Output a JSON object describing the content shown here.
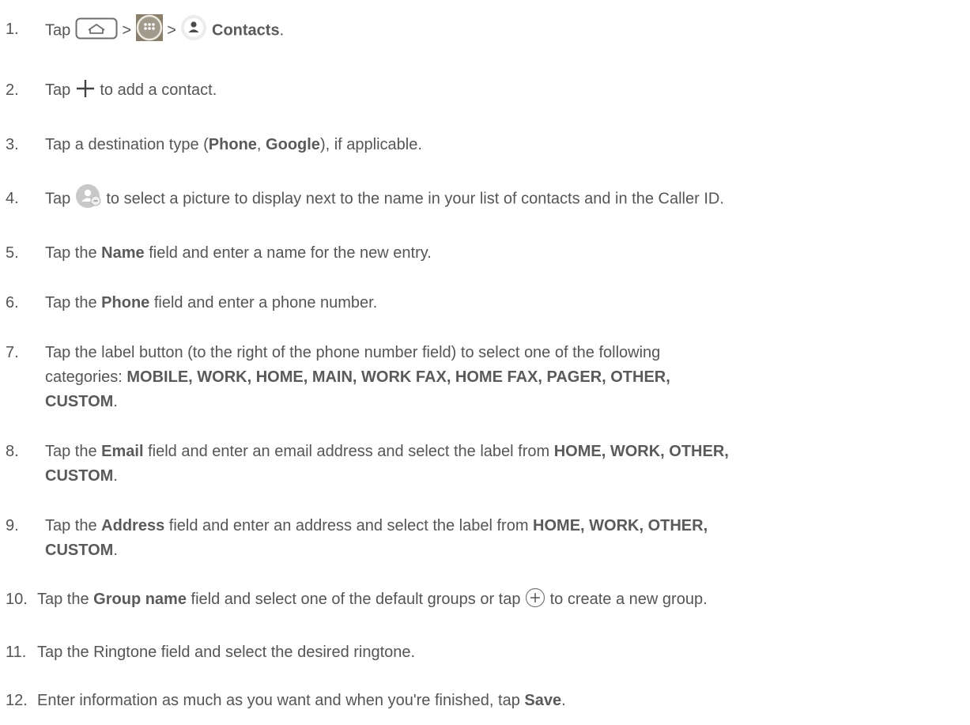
{
  "steps": [
    {
      "num": "1.",
      "t1": "Tap",
      "sep1": ">",
      "sep2": ">",
      "b1": "Contacts",
      "t2": "."
    },
    {
      "num": "2.",
      "t1": "Tap",
      "t2": "to add a contact."
    },
    {
      "num": "3.",
      "t1": "Tap a destination type (",
      "b1": "Phone",
      "t2": ", ",
      "b2": "Google",
      "t3": "), if applicable."
    },
    {
      "num": "4.",
      "t1": "Tap",
      "t2": "to select a picture to display next to the name in your list of contacts and in the Caller ID."
    },
    {
      "num": "5.",
      "t1": "Tap the ",
      "b1": "Name",
      "t2": " field and enter a name for the new entry."
    },
    {
      "num": "6.",
      "t1": "Tap the ",
      "b1": "Phone",
      "t2": " field and enter a phone number."
    },
    {
      "num": "7.",
      "line1": "Tap the label button (to the right of the phone number field) to select one of the following",
      "t1": "categories: ",
      "b1": "MOBILE, WORK, HOME, MAIN, WORK FAX, HOME FAX, PAGER, OTHER,",
      "b2": "CUSTOM",
      "t2": "."
    },
    {
      "num": "8.",
      "t1": "Tap the ",
      "b1": "Email",
      "t2": " field and enter an email address and select the label from ",
      "b2": "HOME, WORK, OTHER,",
      "b3": "CUSTOM",
      "t3": "."
    },
    {
      "num": "9.",
      "t1": "Tap the ",
      "b1": "Address",
      "t2": " field and enter an address and select the label from ",
      "b2": "HOME, WORK, OTHER,",
      "b3": "CUSTOM",
      "t3": "."
    },
    {
      "num": "10.",
      "t1": "Tap the ",
      "b1": "Group name",
      "t2": " field and select one of the default groups or tap",
      "t3": "to create a new group."
    },
    {
      "num": "11.",
      "t1": "Tap the Ringtone field and select the desired ringtone."
    },
    {
      "num": "12.",
      "t1": "Enter information as much as you want and when you're finished, tap ",
      "b1": "Save",
      "t2": "."
    }
  ],
  "icons": {
    "home": "home-key-icon",
    "apps": "apps-icon",
    "contacts": "contacts-icon",
    "add": "add-plus-icon",
    "picture": "contact-picture-icon",
    "add_group": "add-circle-icon"
  },
  "colors": {
    "text": "#555555",
    "icon_gray": "#7a7a7a",
    "apps_bg": "#8a7f6a"
  }
}
